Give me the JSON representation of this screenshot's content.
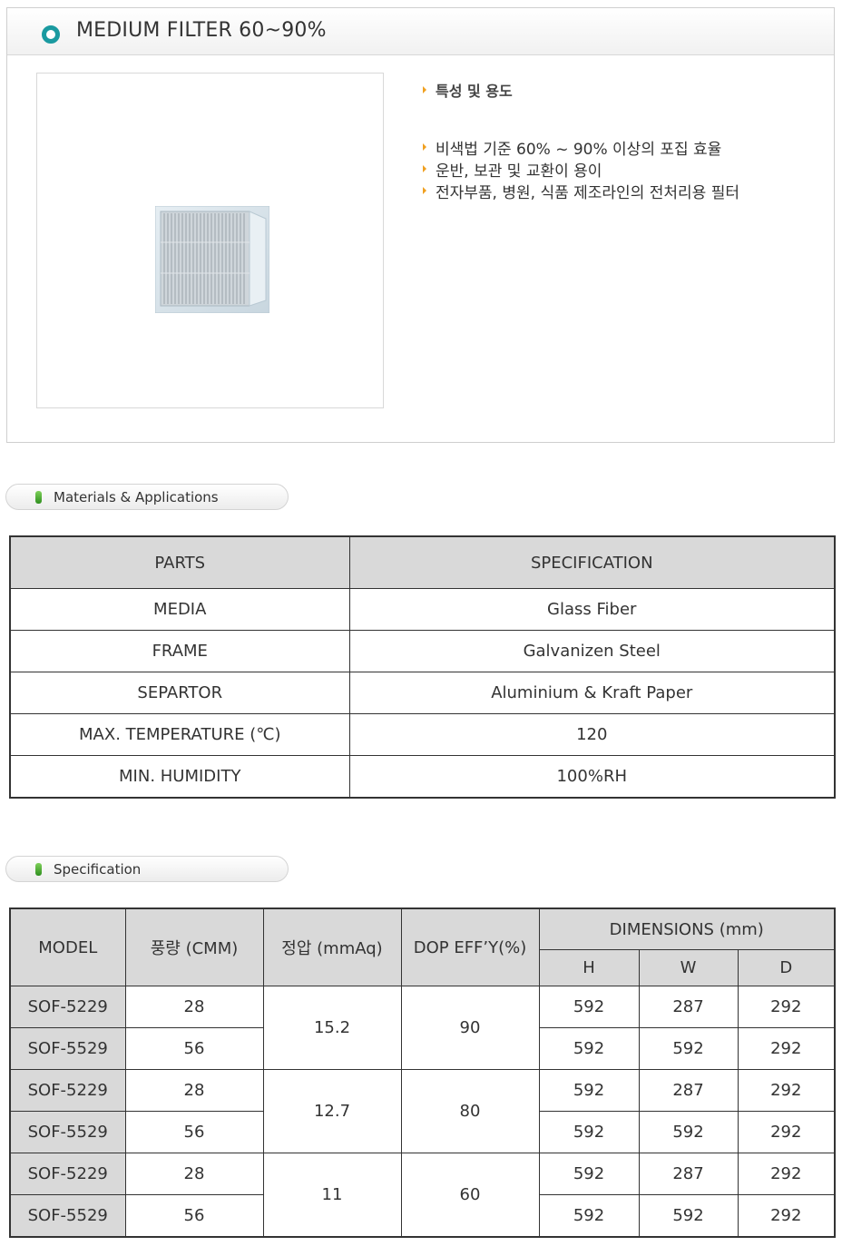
{
  "product": {
    "title": "MEDIUM FILTER 60~90%",
    "image_alt": "filter-product-photo"
  },
  "features": {
    "heading": "특성 및 용도",
    "items": [
      "비색법 기준 60% ~ 90% 이상의 포집 효율",
      "운반, 보관 및 교환이 용이",
      "전자부품, 병원, 식품 제조라인의 전처리용 필터"
    ]
  },
  "materials": {
    "section_label": "Materials & Applications",
    "headers": [
      "PARTS",
      "SPECIFICATION"
    ],
    "rows": [
      [
        "MEDIA",
        "Glass Fiber"
      ],
      [
        "FRAME",
        "Galvanizen Steel"
      ],
      [
        "SEPARTOR",
        "Aluminium & Kraft Paper"
      ],
      [
        "MAX. TEMPERATURE (℃)",
        "120"
      ],
      [
        "MIN. HUMIDITY",
        "100%RH"
      ]
    ]
  },
  "specification": {
    "section_label": "Specification",
    "headers": {
      "model": "MODEL",
      "flow": "풍량 (CMM)",
      "pressure": "정압 (mmAq)",
      "dop": "DOP EFF’Y(%)",
      "dimensions": "DIMENSIONS (mm)",
      "h": "H",
      "w": "W",
      "d": "D"
    },
    "rows": [
      {
        "model": "SOF-5229",
        "flow": "28",
        "pressure": "15.2",
        "dop": "90",
        "h": "592",
        "w": "287",
        "d": "292"
      },
      {
        "model": "SOF-5529",
        "flow": "56",
        "pressure": "",
        "dop": "",
        "h": "592",
        "w": "592",
        "d": "292"
      },
      {
        "model": "SOF-5229",
        "flow": "28",
        "pressure": "12.7",
        "dop": "80",
        "h": "592",
        "w": "287",
        "d": "292"
      },
      {
        "model": "SOF-5529",
        "flow": "56",
        "pressure": "",
        "dop": "",
        "h": "592",
        "w": "592",
        "d": "292"
      },
      {
        "model": "SOF-5229",
        "flow": "28",
        "pressure": "11",
        "dop": "60",
        "h": "592",
        "w": "287",
        "d": "292"
      },
      {
        "model": "SOF-5529",
        "flow": "56",
        "pressure": "",
        "dop": "",
        "h": "592",
        "w": "592",
        "d": "292"
      }
    ]
  },
  "colors": {
    "accent_ring": "#1a9aa0",
    "bullet": "#f0a020",
    "pill_icon": "#3fa02a",
    "header_fill": "#d9d9d9"
  }
}
